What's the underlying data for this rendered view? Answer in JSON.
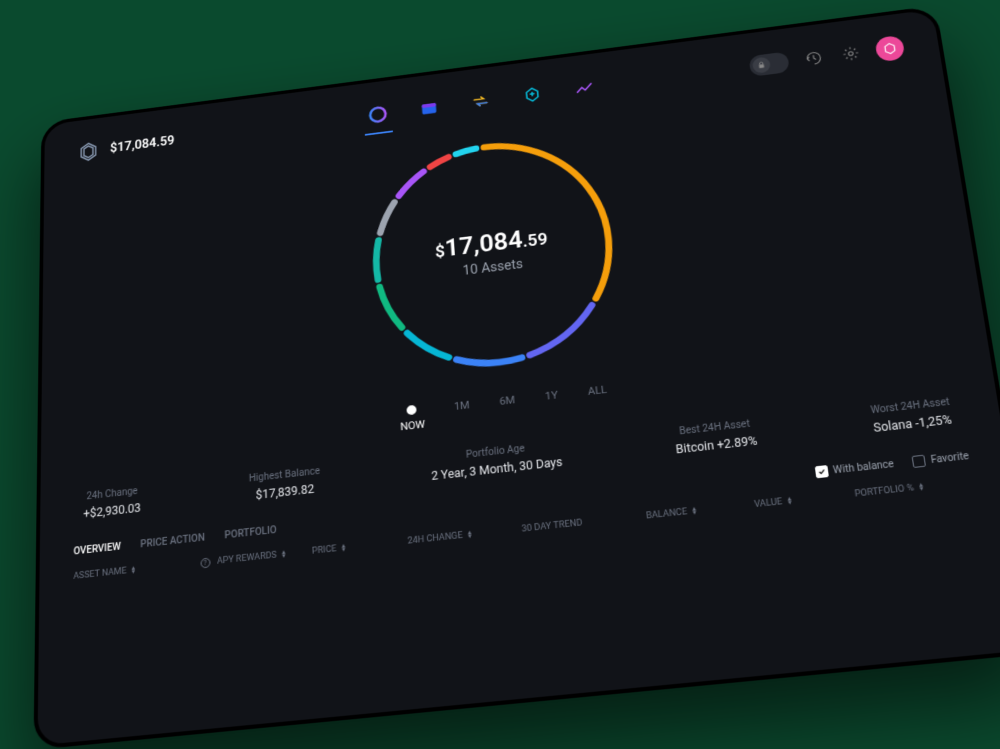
{
  "header": {
    "balance": "$17,084.59"
  },
  "nav": {
    "items": [
      "portfolio-icon",
      "wallet-icon",
      "exchange-icon",
      "earn-icon",
      "activity-icon"
    ]
  },
  "chart_data": {
    "type": "pie",
    "title": "$17,084.59",
    "subtitle": "10 Assets",
    "values_percent": [
      35,
      12,
      10,
      8,
      8,
      7,
      6,
      6,
      4,
      4
    ],
    "colors": [
      "#f59e0b",
      "#6366f1",
      "#3b82f6",
      "#06b6d4",
      "#10b981",
      "#14b8a6",
      "#9ca3af",
      "#a855f7",
      "#ef4444",
      "#22d3ee"
    ]
  },
  "portfolio": {
    "value_dollar": "$",
    "value_main": "17,084",
    "value_cents": ".59",
    "assets_count": "10 Assets"
  },
  "time_range": {
    "options": [
      "NOW",
      "1M",
      "6M",
      "1Y",
      "ALL"
    ],
    "active": "NOW"
  },
  "stats": {
    "change24h": {
      "label": "24h Change",
      "value": "+$2,930.03"
    },
    "highest": {
      "label": "Highest Balance",
      "value": "$17,839.82"
    },
    "age": {
      "label": "Portfolio Age",
      "value": "2 Year, 3 Month, 30 Days"
    },
    "best": {
      "label": "Best 24H Asset",
      "value": "Bitcoin +2.89%"
    },
    "worst": {
      "label": "Worst 24H Asset",
      "value": "Solana -1,25%"
    }
  },
  "tabs": {
    "items": [
      "OVERVIEW",
      "PRICE ACTION",
      "PORTFOLIO"
    ],
    "active": "OVERVIEW"
  },
  "filters": {
    "with_balance": {
      "label": "With balance",
      "checked": true
    },
    "favorite": {
      "label": "Favorite",
      "checked": false
    }
  },
  "table": {
    "columns": [
      "ASSET NAME",
      "APY REWARDS",
      "PRICE",
      "24H CHANGE",
      "30 DAY TREND",
      "BALANCE",
      "VALUE",
      "PORTFOLIO %"
    ]
  }
}
